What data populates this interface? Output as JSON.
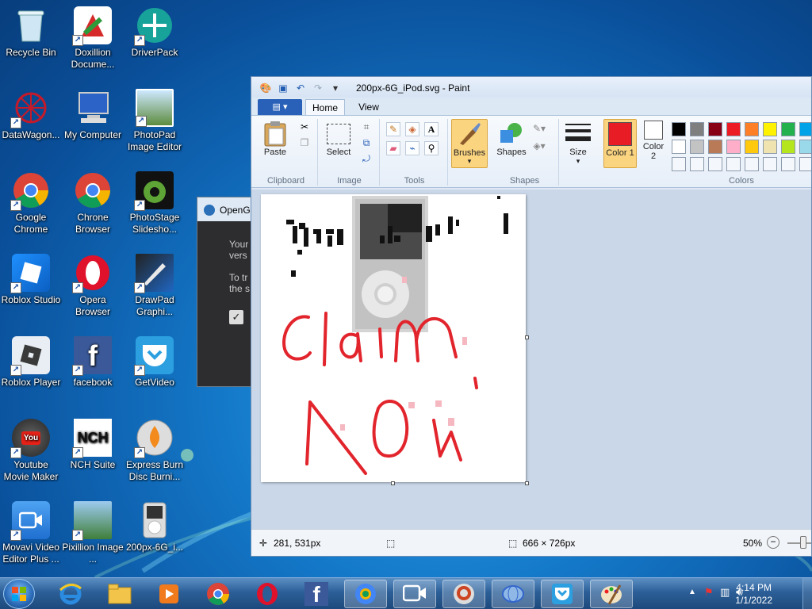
{
  "desktop": {
    "icons": [
      {
        "label": "Recycle Bin"
      },
      {
        "label": "Doxillion Docume..."
      },
      {
        "label": "DriverPack"
      },
      {
        "label": "DataWagon..."
      },
      {
        "label": "My Computer"
      },
      {
        "label": "PhotoPad Image Editor"
      },
      {
        "label": "Google Chrome"
      },
      {
        "label": "Chrone Browser"
      },
      {
        "label": "PhotoStage Slidesho..."
      },
      {
        "label": "Roblox Studio"
      },
      {
        "label": "Opera Browser"
      },
      {
        "label": "DrawPad Graphi..."
      },
      {
        "label": "Roblox Player"
      },
      {
        "label": "facebook"
      },
      {
        "label": "GetVideo"
      },
      {
        "label": "Youtube Movie Maker"
      },
      {
        "label": "NCH Suite"
      },
      {
        "label": "Express Burn Disc Burni..."
      },
      {
        "label": "Movavi Video Editor Plus ..."
      },
      {
        "label": "Pixillion Image ..."
      },
      {
        "label": "200px-6G_i..."
      }
    ]
  },
  "opengl_dialog": {
    "title": "OpenG",
    "line1a": "Your",
    "line1b": "vers",
    "line2a": "To tr",
    "line2b": "the s"
  },
  "paint": {
    "title": "200px-6G_iPod.svg - Paint",
    "tabs": {
      "home": "Home",
      "view": "View"
    },
    "groups": {
      "clipboard": "Clipboard",
      "image": "Image",
      "tools": "Tools",
      "shapes": "Shapes",
      "colors": "Colors"
    },
    "buttons": {
      "paste": "Paste",
      "select": "Select",
      "brushes": "Brushes",
      "shapes": "Shapes",
      "size": "Size",
      "color1": "Color 1",
      "color2": "Color 2"
    },
    "active_color1": "#e81c24",
    "palette_row1": [
      "#000000",
      "#7f7f7f",
      "#880015",
      "#ed1c24",
      "#ff7f27",
      "#fff200",
      "#22b14c",
      "#00a2e8"
    ],
    "palette_row2": [
      "#ffffff",
      "#c3c3c3",
      "#b97a57",
      "#ffaec9",
      "#ffc90e",
      "#efe4b0",
      "#b5e61d",
      "#99d9ea"
    ],
    "status": {
      "cursor_pos": "281, 531px",
      "image_size": "666 × 726px",
      "zoom": "50%"
    },
    "canvas_text": {
      "scrawl1": "Claim",
      "scrawl2": "NOW"
    }
  },
  "taskbar": {
    "time": "4:14 PM",
    "date": "1/1/2022"
  }
}
